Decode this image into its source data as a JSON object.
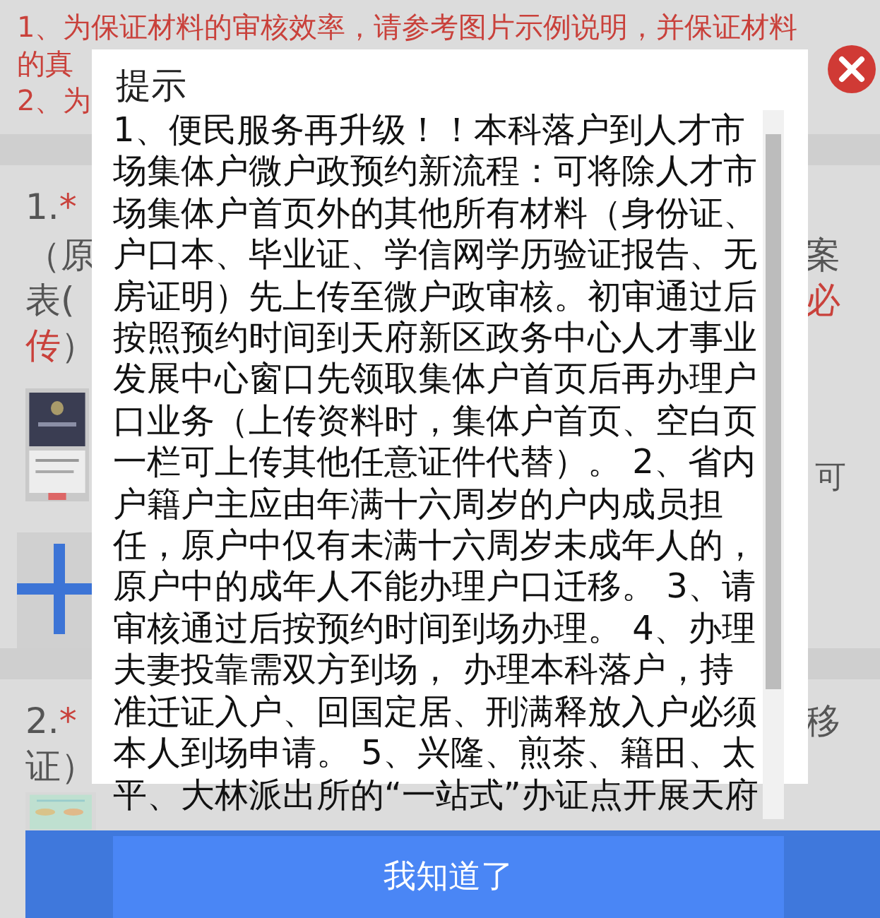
{
  "notice": {
    "lines": [
      "1、为保证材料的审核效率，请参考图片示例说明，并保证材料",
      "的真",
      "2、为"
    ]
  },
  "sections": [
    {
      "number": "1.",
      "mark": "*",
      "lines": [
        {
          "left": [
            {
              "text": "（原",
              "kind": "plain"
            }
          ],
          "right": [
            {
              "text": "案",
              "kind": "plain"
            }
          ]
        },
        {
          "left": [
            {
              "text": "表(",
              "kind": "plain"
            }
          ],
          "right": [
            {
              "text": "必",
              "kind": "required"
            }
          ]
        },
        {
          "left": [
            {
              "text": "传",
              "kind": "required"
            },
            {
              "text": "）",
              "kind": "plain"
            }
          ]
        }
      ],
      "thumbnails": [
        {
          "kind": "picture"
        }
      ],
      "thumb_note": "可",
      "upload_tile": true
    },
    {
      "number": "2.",
      "mark": "*",
      "lines": [
        {
          "right": [
            {
              "text": "移",
              "kind": "plain"
            }
          ]
        },
        {
          "left": [
            {
              "text": "证）",
              "kind": "plain"
            }
          ]
        }
      ],
      "thumbnails": [
        {
          "kind": "picture"
        }
      ]
    }
  ],
  "dialog": {
    "title": "提示",
    "body": "1、便民服务再升级！！本科落户到人才市场集体户微户政预约新流程：可将除人才市场集体户首页外的其他所有材料（身份证、户口本、毕业证、学信网学历验证报告、无房证明）先上传至微户政审核。初审通过后按照预约时间到天府新区政务中心人才事业发展中心窗口先领取集体户首页后再办理户口业务（上传资料时，集体户首页、空白页一栏可上传其他任意证件代替）。 2、省内户籍户主应由年满十六周岁的户内成员担任，原户中仅有未满十六周岁未成年人的，原户中的成年人不能办理户口迁移。 3、请审核通过后按预约时间到场办理。 4、办理夫妻投靠需双方到场， 办理本科落户，持准迁证入户、回国定居、刑满释放入户必须本人到场申请。 5、兴隆、煎茶、籍田、太平、大林派出所的“一站式”办证点开展天府",
    "button": "我知道了"
  }
}
